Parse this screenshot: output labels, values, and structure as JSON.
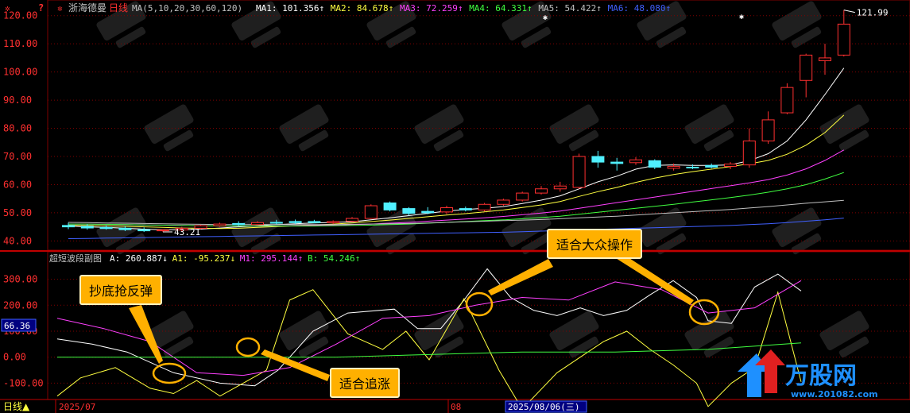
{
  "chart_data": [
    {
      "type": "candlestick",
      "panel": "main",
      "header": {
        "title": "浙海德曼",
        "period": "日线",
        "ma_setting": "MA(5,10,20,30,60,120)",
        "items": [
          {
            "label": "MA1: 101.356↑",
            "color": "#ffffff"
          },
          {
            "label": "MA2: 84.678↑",
            "color": "#ffff40"
          },
          {
            "label": "MA3: 72.259↑",
            "color": "#ff40ff"
          },
          {
            "label": "MA4: 64.331↑",
            "color": "#40ff40"
          },
          {
            "label": "MA5: 54.422↑",
            "color": "#c0c0c0"
          },
          {
            "label": "MA6: 48.080↑",
            "color": "#4060ff"
          }
        ]
      },
      "ylim": [
        37,
        125
      ],
      "yticks": [
        "120.00",
        "110.00",
        "100.00",
        "90.00",
        "80.00",
        "70.00",
        "60.00",
        "50.00",
        "40.00"
      ],
      "ytick_values": [
        120,
        110,
        100,
        90,
        80,
        70,
        60,
        50,
        40
      ],
      "high_label": "121.99",
      "low_label": "43.21",
      "candles": [
        {
          "o": 45.5,
          "h": 46.5,
          "l": 44.2,
          "c": 45.0,
          "up": false
        },
        {
          "o": 45.2,
          "h": 46.0,
          "l": 44.0,
          "c": 44.6,
          "up": false
        },
        {
          "o": 44.8,
          "h": 45.6,
          "l": 44.0,
          "c": 44.4,
          "up": false
        },
        {
          "o": 44.5,
          "h": 45.2,
          "l": 43.5,
          "c": 44.0,
          "up": false
        },
        {
          "o": 44.0,
          "h": 44.8,
          "l": 43.2,
          "c": 43.6,
          "up": false
        },
        {
          "o": 43.6,
          "h": 44.2,
          "l": 43.21,
          "c": 43.9,
          "up": true
        },
        {
          "o": 43.9,
          "h": 45.0,
          "l": 43.5,
          "c": 44.5,
          "up": true
        },
        {
          "o": 44.5,
          "h": 45.8,
          "l": 44.2,
          "c": 45.4,
          "up": true
        },
        {
          "o": 45.4,
          "h": 46.5,
          "l": 45.0,
          "c": 46.0,
          "up": true
        },
        {
          "o": 46.2,
          "h": 47.0,
          "l": 45.3,
          "c": 45.8,
          "up": false
        },
        {
          "o": 45.8,
          "h": 47.0,
          "l": 45.5,
          "c": 46.5,
          "up": true
        },
        {
          "o": 46.6,
          "h": 47.5,
          "l": 45.9,
          "c": 46.3,
          "up": false
        },
        {
          "o": 46.5,
          "h": 47.6,
          "l": 46.0,
          "c": 46.9,
          "up": false
        },
        {
          "o": 46.9,
          "h": 47.5,
          "l": 46.3,
          "c": 46.5,
          "up": false
        },
        {
          "o": 46.5,
          "h": 47.3,
          "l": 46.0,
          "c": 46.9,
          "up": true
        },
        {
          "o": 47.0,
          "h": 48.5,
          "l": 46.8,
          "c": 48.0,
          "up": true
        },
        {
          "o": 48.0,
          "h": 53.0,
          "l": 47.8,
          "c": 52.5,
          "up": true
        },
        {
          "o": 53.5,
          "h": 54.0,
          "l": 50.5,
          "c": 51.0,
          "up": false
        },
        {
          "o": 51.5,
          "h": 52.0,
          "l": 49.0,
          "c": 49.8,
          "up": false
        },
        {
          "o": 50.0,
          "h": 52.0,
          "l": 49.5,
          "c": 50.5,
          "up": false
        },
        {
          "o": 50.3,
          "h": 52.5,
          "l": 49.5,
          "c": 51.8,
          "up": true
        },
        {
          "o": 51.5,
          "h": 52.2,
          "l": 50.5,
          "c": 51.0,
          "up": false
        },
        {
          "o": 51.0,
          "h": 53.5,
          "l": 50.5,
          "c": 53.0,
          "up": true
        },
        {
          "o": 53.0,
          "h": 55.0,
          "l": 52.5,
          "c": 54.5,
          "up": true
        },
        {
          "o": 54.5,
          "h": 57.5,
          "l": 54.0,
          "c": 57.0,
          "up": true
        },
        {
          "o": 57.0,
          "h": 59.5,
          "l": 56.5,
          "c": 58.5,
          "up": true
        },
        {
          "o": 58.5,
          "h": 61.0,
          "l": 57.5,
          "c": 59.5,
          "up": true
        },
        {
          "o": 59.0,
          "h": 71.0,
          "l": 58.5,
          "c": 70.0,
          "up": true
        },
        {
          "o": 70.0,
          "h": 72.0,
          "l": 66.0,
          "c": 68.0,
          "up": false
        },
        {
          "o": 68.0,
          "h": 69.5,
          "l": 65.0,
          "c": 67.5,
          "up": false
        },
        {
          "o": 67.8,
          "h": 69.8,
          "l": 67.0,
          "c": 68.8,
          "up": true
        },
        {
          "o": 68.5,
          "h": 69.0,
          "l": 65.5,
          "c": 66.2,
          "up": false
        },
        {
          "o": 66.5,
          "h": 67.5,
          "l": 65.0,
          "c": 65.8,
          "up": true
        },
        {
          "o": 66.0,
          "h": 67.2,
          "l": 65.5,
          "c": 66.2,
          "up": false
        },
        {
          "o": 66.2,
          "h": 67.5,
          "l": 65.8,
          "c": 66.8,
          "up": false
        },
        {
          "o": 66.5,
          "h": 68.0,
          "l": 65.5,
          "c": 67.3,
          "up": true
        },
        {
          "o": 67.0,
          "h": 80.0,
          "l": 66.0,
          "c": 75.5,
          "up": true
        },
        {
          "o": 75.5,
          "h": 86.0,
          "l": 74.5,
          "c": 83.0,
          "up": true
        },
        {
          "o": 85.5,
          "h": 96.0,
          "l": 85.0,
          "c": 94.5,
          "up": true
        },
        {
          "o": 97.0,
          "h": 106.5,
          "l": 91.0,
          "c": 106.0,
          "up": true
        },
        {
          "o": 104.0,
          "h": 110.0,
          "l": 99.0,
          "c": 105.0,
          "up": true
        },
        {
          "o": 106.0,
          "h": 121.99,
          "l": 105.5,
          "c": 117.0,
          "up": true
        }
      ],
      "ma_lines": [
        {
          "name": "MA1",
          "color": "#ffffff",
          "values": [
            45.3,
            45.0,
            44.8,
            44.5,
            44.2,
            44.0,
            44.0,
            44.2,
            44.6,
            45.0,
            45.4,
            45.8,
            46.1,
            46.4,
            46.6,
            46.8,
            47.5,
            48.2,
            49.0,
            49.8,
            50.6,
            51.2,
            51.6,
            52.2,
            53.3,
            54.5,
            56.0,
            58.5,
            61.0,
            63.0,
            65.5,
            66.8,
            67.0,
            66.8,
            66.8,
            67.0,
            68.5,
            71.0,
            75.5,
            83.0,
            92.0,
            101.4
          ]
        },
        {
          "name": "MA2",
          "color": "#ffff40",
          "values": [
            45.6,
            45.5,
            45.4,
            45.2,
            45.0,
            44.8,
            44.6,
            44.5,
            44.4,
            44.5,
            44.8,
            45.1,
            45.4,
            45.7,
            46.0,
            46.4,
            46.9,
            47.4,
            48.0,
            48.6,
            49.2,
            49.7,
            50.3,
            51.0,
            51.9,
            52.8,
            54.0,
            55.8,
            57.5,
            59.0,
            60.8,
            62.3,
            63.6,
            64.6,
            65.5,
            66.4,
            67.4,
            68.6,
            70.8,
            74.0,
            78.5,
            84.7
          ]
        },
        {
          "name": "MA3",
          "color": "#ff40ff",
          "values": [
            46.0,
            46.0,
            45.9,
            45.8,
            45.7,
            45.6,
            45.5,
            45.4,
            45.3,
            45.3,
            45.3,
            45.3,
            45.4,
            45.5,
            45.6,
            45.8,
            46.0,
            46.3,
            46.6,
            47.0,
            47.4,
            47.8,
            48.2,
            48.7,
            49.3,
            49.9,
            50.6,
            51.6,
            52.6,
            53.6,
            54.6,
            55.6,
            56.6,
            57.6,
            58.6,
            59.6,
            60.6,
            61.8,
            63.4,
            65.6,
            68.6,
            72.3
          ]
        },
        {
          "name": "MA4",
          "color": "#40ff40",
          "values": [
            46.0,
            46.0,
            45.9,
            45.8,
            45.7,
            45.6,
            45.5,
            45.4,
            45.3,
            45.3,
            45.3,
            45.3,
            45.3,
            45.3,
            45.4,
            45.5,
            45.6,
            45.8,
            46.0,
            46.3,
            46.6,
            46.9,
            47.2,
            47.5,
            47.9,
            48.3,
            48.8,
            49.5,
            50.2,
            50.9,
            51.6,
            52.3,
            53.0,
            53.8,
            54.6,
            55.4,
            56.3,
            57.3,
            58.5,
            60.0,
            62.0,
            64.3
          ]
        },
        {
          "name": "MA5",
          "color": "#c0c0c0",
          "values": [
            46.6,
            46.5,
            46.4,
            46.3,
            46.2,
            46.1,
            46.0,
            45.9,
            45.8,
            45.8,
            45.8,
            45.8,
            45.8,
            45.8,
            45.8,
            45.9,
            46.0,
            46.1,
            46.2,
            46.4,
            46.6,
            46.8,
            47.0,
            47.2,
            47.4,
            47.6,
            47.9,
            48.2,
            48.5,
            48.8,
            49.2,
            49.6,
            50.0,
            50.4,
            50.8,
            51.2,
            51.7,
            52.2,
            52.8,
            53.4,
            53.9,
            54.4
          ]
        },
        {
          "name": "MA6",
          "color": "#4060ff",
          "values": [
            40.8,
            40.9,
            41.0,
            41.1,
            41.2,
            41.3,
            41.4,
            41.5,
            41.6,
            41.7,
            41.8,
            41.9,
            42.0,
            42.1,
            42.2,
            42.3,
            42.4,
            42.5,
            42.6,
            42.7,
            42.8,
            42.9,
            43.0,
            43.1,
            43.3,
            43.5,
            43.7,
            43.9,
            44.1,
            44.3,
            44.5,
            44.7,
            44.9,
            45.1,
            45.3,
            45.5,
            45.8,
            46.1,
            46.5,
            47.0,
            47.5,
            48.1
          ]
        }
      ]
    },
    {
      "type": "line",
      "panel": "indicator",
      "header": {
        "title": "超短波段副图",
        "items": [
          {
            "label": "A: 260.887↓",
            "color": "#ffffff"
          },
          {
            "label": "A1: -95.237↓",
            "color": "#ffff40"
          },
          {
            "label": "M1: 295.144↑",
            "color": "#ff40ff"
          },
          {
            "label": "B: 54.246↑",
            "color": "#40ff40"
          }
        ]
      },
      "ylim": [
        -160,
        360
      ],
      "yticks": [
        "300.00",
        "200.00",
        "100.00",
        "0.00",
        "-100.00"
      ],
      "ytick_values": [
        300,
        200,
        100,
        0,
        -100
      ],
      "cursor_value": "66.36",
      "cursor_y": 66.36,
      "series": [
        {
          "name": "A",
          "color": "#ffffff",
          "x": [
            0,
            3,
            6,
            10,
            14,
            17,
            19,
            22,
            25,
            29,
            31,
            33,
            35,
            37,
            39,
            41,
            43,
            45,
            47,
            49,
            51,
            53,
            55,
            56,
            58,
            60,
            62,
            64
          ],
          "values": [
            70,
            50,
            20,
            -60,
            -100,
            -110,
            -50,
            100,
            170,
            185,
            110,
            110,
            220,
            340,
            230,
            180,
            160,
            190,
            160,
            180,
            240,
            295,
            230,
            140,
            130,
            270,
            320,
            255
          ]
        },
        {
          "name": "A1",
          "color": "#ffff40",
          "x": [
            0,
            2,
            5,
            8,
            10,
            12,
            14,
            16,
            18,
            20,
            22,
            25,
            28,
            30,
            32,
            35,
            38,
            40,
            43,
            45,
            47,
            49,
            51,
            53,
            55,
            56,
            58,
            60,
            62,
            64
          ],
          "values": [
            -150,
            -80,
            -40,
            -120,
            -140,
            -90,
            -150,
            -100,
            -50,
            220,
            260,
            90,
            30,
            100,
            -10,
            225,
            -50,
            -200,
            -60,
            0,
            60,
            100,
            30,
            -30,
            -100,
            -190,
            -100,
            -40,
            250,
            -95
          ]
        },
        {
          "name": "M1",
          "color": "#ff40ff",
          "x": [
            0,
            4,
            8,
            12,
            16,
            20,
            24,
            28,
            32,
            36,
            40,
            44,
            48,
            52,
            56,
            60,
            64
          ],
          "values": [
            150,
            110,
            60,
            -60,
            -70,
            -40,
            50,
            150,
            160,
            200,
            230,
            220,
            290,
            260,
            170,
            190,
            295
          ]
        },
        {
          "name": "B",
          "color": "#40ff40",
          "x": [
            0,
            8,
            16,
            24,
            32,
            40,
            48,
            56,
            64
          ],
          "values": [
            0,
            0,
            0,
            0,
            10,
            20,
            20,
            30,
            55
          ]
        }
      ],
      "x_max": 64
    }
  ],
  "bottom_axis": {
    "period_tag": "日线▲",
    "date_start": "2025/07",
    "month_mark": "08",
    "cursor_date": "2025/08/06(三)"
  },
  "annotations": [
    {
      "text": "抄底抢反弹"
    },
    {
      "text": "适合追涨"
    },
    {
      "text": "适合大众操作"
    }
  ],
  "logo": {
    "text": "万股网",
    "url": "www.201082.com"
  },
  "colors": {
    "grid": "#800000",
    "axis_text": "#ff3030",
    "up": "#ff3030",
    "down": "#50f0ff",
    "annotation_fill": "#ffb000"
  }
}
